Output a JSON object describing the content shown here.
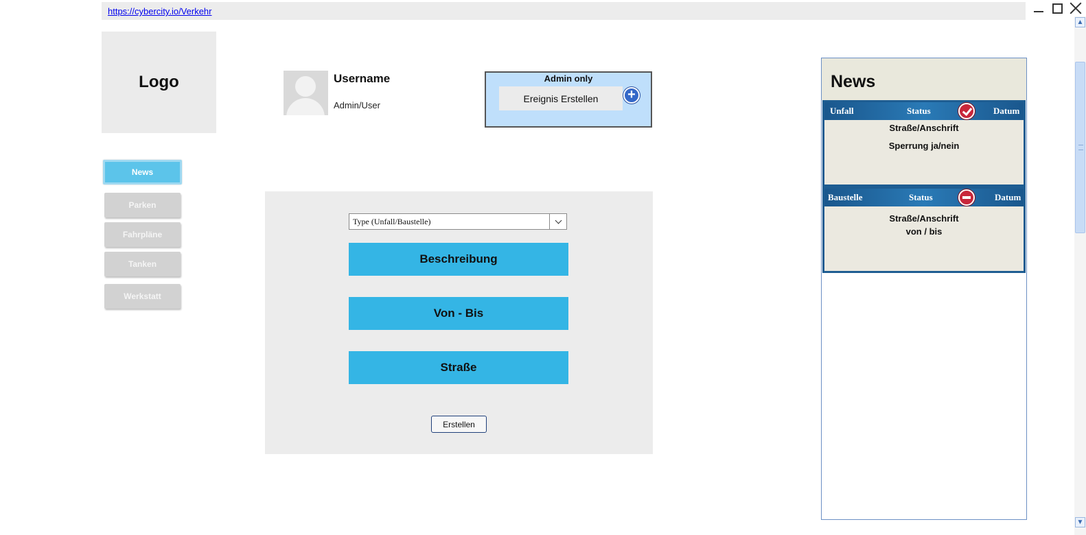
{
  "browser": {
    "url": "https://cybercity.io/Verkehr"
  },
  "logo": {
    "label": "Logo"
  },
  "nav": {
    "items": [
      {
        "label": "News",
        "active": true
      },
      {
        "label": "Parken",
        "active": false
      },
      {
        "label": "Fahrpläne",
        "active": false
      },
      {
        "label": "Tanken",
        "active": false
      },
      {
        "label": "Werkstatt",
        "active": false
      }
    ]
  },
  "user": {
    "name": "Username",
    "role": "Admin/User"
  },
  "admin": {
    "title": "Admin only",
    "create_event_label": "Ereignis Erstellen"
  },
  "form": {
    "type_select_value": "Type (Unfall/Baustelle)",
    "description_label": "Beschreibung",
    "date_range_label": "Von - Bis",
    "street_label": "Straße",
    "submit_label": "Erstellen"
  },
  "news": {
    "title": "News",
    "cards": [
      {
        "type": "Unfall",
        "status_label": "Status",
        "status_icon": "check-circle-icon",
        "date_label": "Datum",
        "line1": "Straße/Anschrift",
        "line2": "Sperrung ja/nein"
      },
      {
        "type": "Baustelle",
        "status_label": "Status",
        "status_icon": "minus-circle-icon",
        "date_label": "Datum",
        "line1": "Straße/Anschrift",
        "line2": "von / bis"
      }
    ]
  },
  "colors": {
    "accent": "#34b5e5",
    "nav_active": "#5cc4ea",
    "admin_bg": "#bfdffb",
    "card_header": "#1a578d",
    "status_icon": "#c8263a"
  }
}
